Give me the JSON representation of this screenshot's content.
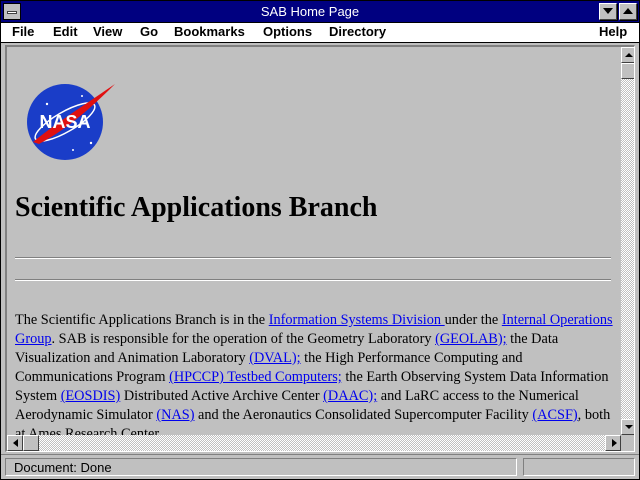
{
  "window": {
    "title": "SAB Home Page"
  },
  "menu": {
    "file": "File",
    "edit": "Edit",
    "view": "View",
    "go": "Go",
    "bookmarks": "Bookmarks",
    "options": "Options",
    "directory": "Directory",
    "help": "Help"
  },
  "page": {
    "logo_text": "NASA",
    "heading": "Scientific Applications Branch",
    "paragraph": [
      {
        "t": "The Scientific Applications Branch is in the "
      },
      {
        "a": "Information Systems Division "
      },
      {
        "t": "under the "
      },
      {
        "a": "Internal Operations Group"
      },
      {
        "t": ". SAB is responsible for the operation of the Geometry Laboratory "
      },
      {
        "a": "(GEOLAB);"
      },
      {
        "t": " the Data Visualization and Animation Laboratory "
      },
      {
        "a": "(DVAL);"
      },
      {
        "t": " the High Performance Computing and Communications Program "
      },
      {
        "a": "(HPCCP) Testbed Computers;"
      },
      {
        "t": " the Earth Observing System Data Information System "
      },
      {
        "a": "(EOSDIS)"
      },
      {
        "t": " Distributed Active Archive Center "
      },
      {
        "a": "(DAAC);"
      },
      {
        "t": " and LaRC access to the Numerical Aerodynamic Simulator "
      },
      {
        "a": "(NAS)"
      },
      {
        "t": " and the Aeronautics Consolidated Supercomputer Facility "
      },
      {
        "a": "(ACSF)"
      },
      {
        "t": ", both at Ames Research Center."
      }
    ]
  },
  "status": {
    "text": "Document: Done"
  },
  "icons": {
    "system_menu": "system-menu-icon",
    "minimize": "triangle-down-icon",
    "maximize": "triangle-up-icon",
    "scroll_up": "arrow-up-icon",
    "scroll_down": "arrow-down-icon",
    "scroll_left": "arrow-left-icon",
    "scroll_right": "arrow-right-icon"
  },
  "colors": {
    "titlebar": "#000080",
    "link": "#0000ee",
    "chrome": "#c0c0c0"
  }
}
